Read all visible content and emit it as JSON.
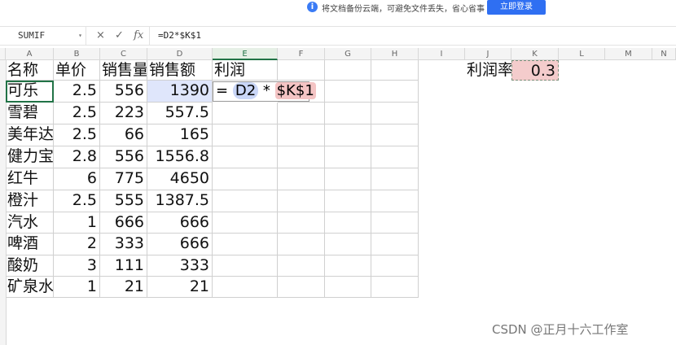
{
  "banner": {
    "info_icon": "info-icon",
    "text": "将文档备份云端，可避免文件丢失，省心省事",
    "login_label": "立即登录",
    "accent": "#2f6ff2"
  },
  "formula_bar": {
    "name_box": "SUMIF",
    "cancel_icon": "×",
    "confirm_icon": "✓",
    "fx_label": "fx",
    "formula": "=D2*$K$1"
  },
  "columns": [
    "A",
    "B",
    "C",
    "D",
    "E",
    "F",
    "G",
    "H",
    "I",
    "J",
    "K",
    "L",
    "M",
    "N"
  ],
  "selected_column": "E",
  "table": {
    "headers": [
      "名称",
      "单价",
      "销售量",
      "销售额",
      "利润"
    ],
    "rows": [
      [
        "可乐",
        "2.5",
        "556",
        "1390"
      ],
      [
        "雪碧",
        "2.5",
        "223",
        "557.5"
      ],
      [
        "美年达",
        "2.5",
        "66",
        "165"
      ],
      [
        "健力宝",
        "2.8",
        "556",
        "1556.8"
      ],
      [
        "红牛",
        "6",
        "775",
        "4650"
      ],
      [
        "橙汁",
        "2.5",
        "555",
        "1387.5"
      ],
      [
        "汽水",
        "1",
        "666",
        "666"
      ],
      [
        "啤酒",
        "2",
        "333",
        "666"
      ],
      [
        "酸奶",
        "3",
        "111",
        "333"
      ],
      [
        "矿泉水",
        "1",
        "21",
        "21"
      ]
    ]
  },
  "editing_cell": {
    "eq": "=",
    "ref1": "D2",
    "op": "*",
    "ref2": "$K$1"
  },
  "rate": {
    "label": "利润率",
    "value": "0.3",
    "highlight": "#f4cccc"
  },
  "watermark": "CSDN @正月十六工作室"
}
